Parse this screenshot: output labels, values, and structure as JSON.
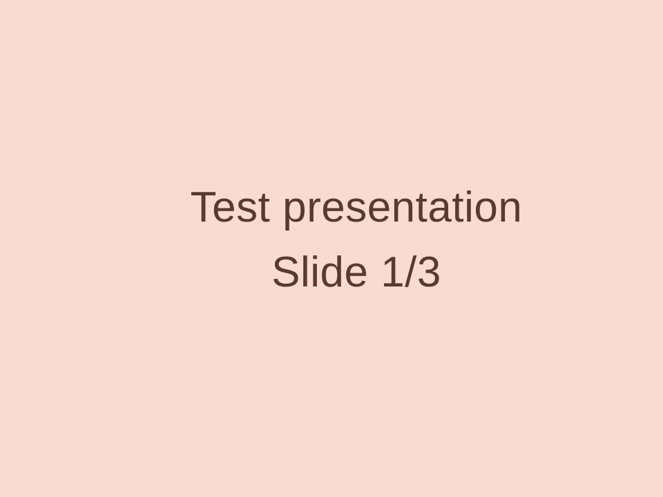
{
  "slide": {
    "title_line1": "Test presentation",
    "title_line2": "Slide 1/3",
    "background_color": "#f9dbd3",
    "text_color": "#573a30"
  }
}
